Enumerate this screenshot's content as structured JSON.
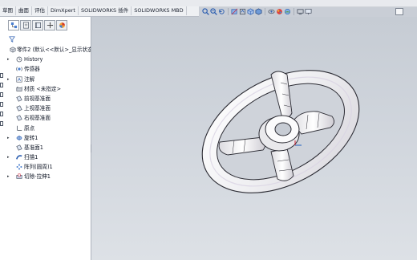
{
  "command_tabs": [
    {
      "label": "草图",
      "active": false
    },
    {
      "label": "曲面",
      "active": false
    },
    {
      "label": "评估",
      "active": false
    },
    {
      "label": "DimXpert",
      "active": false
    },
    {
      "label": "SOLIDWORKS 插件",
      "active": false
    },
    {
      "label": "SOLIDWORKS MBD",
      "active": false
    }
  ],
  "view_toolbar_icons": [
    "zoom-to-fit-icon",
    "zoom-area-icon",
    "previous-view-icon",
    "section-view-icon",
    "dynamic-annotation-icon",
    "view-orientation-icon",
    "display-style-icon",
    "hide-show-icon",
    "edit-appearance-icon",
    "scene-icon",
    "view-settings-icon",
    "monitor-icon"
  ],
  "panel_tabs": [
    "feature-manager-icon",
    "property-manager-icon",
    "configuration-manager-icon",
    "dimxpert-manager-icon",
    "display-manager-icon"
  ],
  "feature_tree": {
    "root": "零件2 (默认<<默认>_显示状态",
    "items": [
      {
        "label": "History",
        "icon": "history-icon",
        "expandable": true
      },
      {
        "label": "传感器",
        "icon": "sensor-icon",
        "expandable": false
      },
      {
        "label": "注解",
        "icon": "annotations-icon",
        "expandable": true
      },
      {
        "label": "材质 <未指定>",
        "icon": "material-icon",
        "expandable": false
      },
      {
        "label": "前视基准面",
        "icon": "plane-icon",
        "expandable": false
      },
      {
        "label": "上视基准面",
        "icon": "plane-icon",
        "expandable": false
      },
      {
        "label": "右视基准面",
        "icon": "plane-icon",
        "expandable": false
      },
      {
        "label": "原点",
        "icon": "origin-icon",
        "expandable": false
      },
      {
        "label": "旋转1",
        "icon": "revolve-icon",
        "expandable": true
      },
      {
        "label": "基准面1",
        "icon": "plane-icon",
        "expandable": false
      },
      {
        "label": "扫描1",
        "icon": "sweep-icon",
        "expandable": true
      },
      {
        "label": "阵列(圆周)1",
        "icon": "circular-pattern-icon",
        "expandable": false
      },
      {
        "label": "切除-拉伸1",
        "icon": "cut-extrude-icon",
        "expandable": true
      }
    ]
  },
  "colors": {
    "accent": "#1f5fbf",
    "viewport_top": "#c6ccd4",
    "viewport_bottom": "#dde1e6",
    "model_surface": "#f2f2f4"
  }
}
